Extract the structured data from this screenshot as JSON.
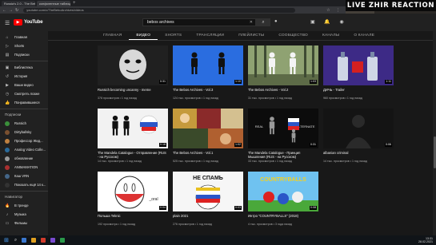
{
  "browser": {
    "tabs": [
      {
        "label": "Russia's 2.0 - The Bebo",
        "active": false
      },
      {
        "label": "конфигенные таблицы - Google",
        "active": true
      }
    ],
    "new_tab": "+",
    "window_controls": "— ☐ ✕",
    "url": "youtube.com/c/TheBeboArchives/videos",
    "nav": {
      "back": "←",
      "forward": "→",
      "reload": "↻"
    }
  },
  "overlay": {
    "title": "LIVE ZHIR REACTION"
  },
  "youtube": {
    "logo": "YouTube",
    "search_value": "bebos archives",
    "search_clear": "✕",
    "channel_tabs": [
      {
        "label": "ГЛАВНАЯ",
        "active": false
      },
      {
        "label": "ВИДЕО",
        "active": true
      },
      {
        "label": "SHORTS",
        "active": false
      },
      {
        "label": "ТРАНСЛЯЦИИ",
        "active": false
      },
      {
        "label": "ПЛЕЙЛИСТЫ",
        "active": false
      },
      {
        "label": "СООБЩЕСТВО",
        "active": false
      },
      {
        "label": "КАНАЛЫ",
        "active": false
      },
      {
        "label": "О КАНАЛЕ",
        "active": false
      }
    ]
  },
  "sidebar": {
    "main": [
      {
        "label": "Главная",
        "icon": "home-icon",
        "glyph": "⌂"
      },
      {
        "label": "Shorts",
        "icon": "shorts-icon",
        "glyph": "▷"
      },
      {
        "label": "Подписки",
        "icon": "subscriptions-icon",
        "glyph": "▤"
      }
    ],
    "library": [
      {
        "label": "Библиотека",
        "icon": "library-icon",
        "glyph": "▣"
      },
      {
        "label": "История",
        "icon": "history-icon",
        "glyph": "↺"
      },
      {
        "label": "Ваши видео",
        "icon": "your-videos-icon",
        "glyph": "▶"
      },
      {
        "label": "Смотреть позже",
        "icon": "watch-later-icon",
        "glyph": "◷"
      },
      {
        "label": "Понравившиеся",
        "icon": "liked-icon",
        "glyph": "👍"
      }
    ],
    "subs_title": "Подписки",
    "subscriptions": [
      {
        "label": "Russich",
        "color": "#3a8f3a"
      },
      {
        "label": "Dirtyballsky",
        "color": "#7a5030"
      },
      {
        "label": "Профессор Жид...",
        "color": "#c08040"
      },
      {
        "label": "Analog Video Colle...",
        "color": "#2a6a9a"
      },
      {
        "label": "обновление",
        "color": "#9a9a9a"
      },
      {
        "label": "ANIMAMATION",
        "color": "#aa3030"
      },
      {
        "label": "Каш VRN",
        "color": "#446688"
      },
      {
        "label": "Показать ещё 14 к...",
        "color": "#333333"
      }
    ],
    "nav_title": "Навигатор",
    "navigator": [
      {
        "label": "В тренде",
        "icon": "trending-icon",
        "glyph": "🔥"
      },
      {
        "label": "Музыка",
        "icon": "music-icon",
        "glyph": "♪"
      },
      {
        "label": "Фильмы",
        "icon": "movies-icon",
        "glyph": "▭"
      }
    ]
  },
  "videos": [
    {
      "title": "Russich becoming uncanny - meme",
      "meta": "378 просмотров • 1 год назад",
      "duration": "0:31",
      "thumb": "uncanny-face"
    },
    {
      "title": "The Bebos Archives - Vol.3",
      "meta": "124 тыс. просмотров • 1 год назад",
      "duration": "1:10",
      "thumb": "figures-blue"
    },
    {
      "title": "The Bebos Archives - Vol.2",
      "meta": "31 тыс. просмотров • 1 год назад",
      "duration": "1:03",
      "thumb": "figures-forest"
    },
    {
      "title": "ДИЧЬ - Trailer",
      "meta": "960 просмотров • 1 год назад",
      "duration": "1:11",
      "thumb": "bottles-purple"
    },
    {
      "title": "The Mandela Catalogue - Отправление (RUS - на Русском)",
      "meta": "14 тыс. просмотров • 1 год назад",
      "duration": "0:18",
      "thumb": "figures-flag"
    },
    {
      "title": "The Bebos Archives - Vol.1",
      "meta": "525 тыс. просмотров • 1 год назад",
      "duration": "1:02",
      "thumb": "collage"
    },
    {
      "title": "The Mandela Catalogue - Принцип Мышления (RUS - на Русском)",
      "meta": "33 тыс. просмотров • 1 год назад",
      "duration": "0:31",
      "thumb": "real-alternate"
    },
    {
      "title": "albanian criminal",
      "meta": "14 тыс. просмотров • 1 год назад",
      "duration": "0:06",
      "thumb": "dark-figure"
    },
    {
      "title": "Польша Teknic",
      "meta": "192 просмотра • 1 год назад",
      "duration": "0:04",
      "thumb": "polandball-sketch"
    },
    {
      "title": "plain 2021",
      "meta": "276 просмотров • 1 год назад",
      "duration": "0:03",
      "thumb": "ne-spat"
    },
    {
      "title": "Интро \"COUNTRYBALLS\" (2018)",
      "meta": "4 тыс. просмотров • 3 года назад",
      "duration": "0:08",
      "thumb": "countryballs"
    }
  ],
  "thumb_text": {
    "real": "REAL",
    "alternate": "ALTERNATE",
    "ne_spat": "НЕ СПАМЬ",
    "countryballs": "COUNTRYBALLS",
    "sketch": "_oral"
  },
  "taskbar": {
    "time": "13:31",
    "date": "28.02.2021"
  }
}
